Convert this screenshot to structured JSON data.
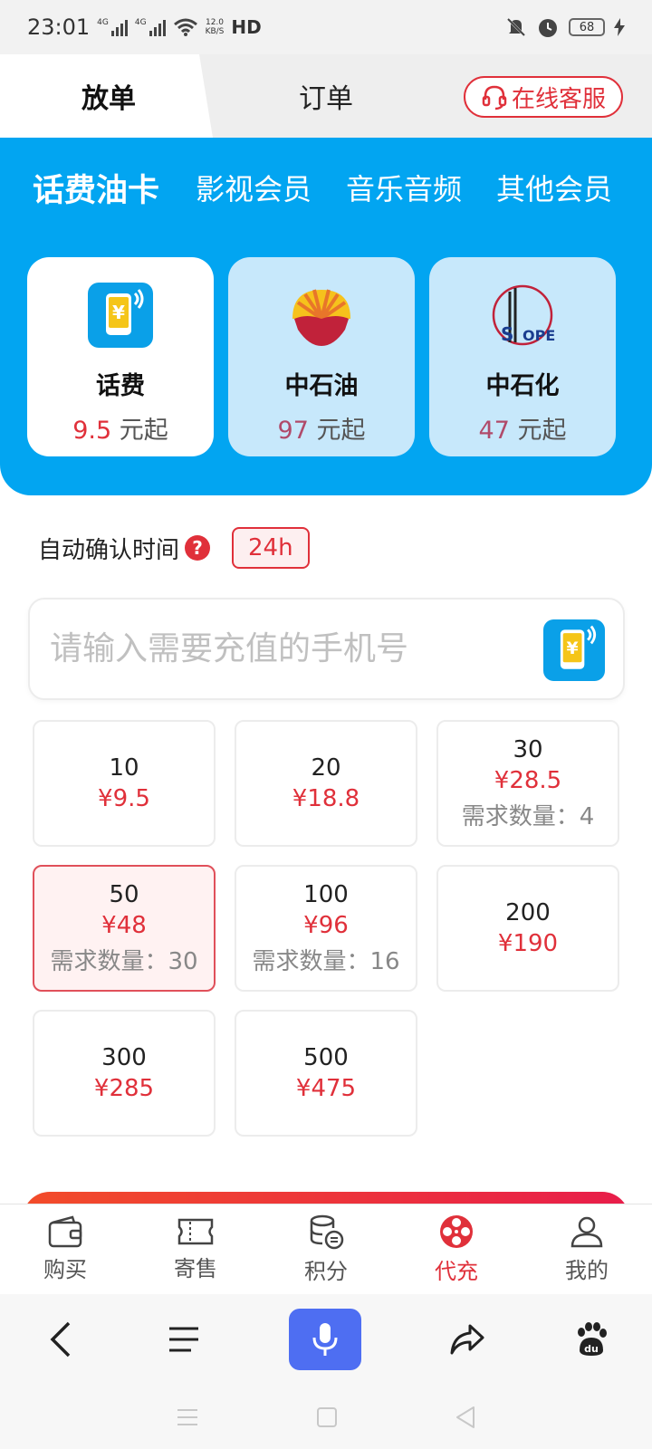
{
  "status_bar": {
    "time": "23:01",
    "signal_1": "4G",
    "signal_2": "4G",
    "net_speed_value": "12.0",
    "net_speed_unit": "KB/S",
    "hd": "HD",
    "battery": "68"
  },
  "top_tabs": {
    "tab_1": "放单",
    "tab_2": "订单",
    "service": "在线客服"
  },
  "category_tabs": [
    "话费油卡",
    "影视会员",
    "音乐音频",
    "其他会员"
  ],
  "cards": [
    {
      "title": "话费",
      "price": "9.5",
      "suffix": "元起",
      "icon": "phone-recharge-icon"
    },
    {
      "title": "中石油",
      "price": "97",
      "suffix": "元起",
      "icon": "petrochina-logo"
    },
    {
      "title": "中石化",
      "price": "47",
      "suffix": "元起",
      "icon": "sinopec-logo"
    }
  ],
  "auto_confirm": {
    "label": "自动确认时间",
    "value": "24h"
  },
  "phone_input": {
    "placeholder": "请输入需要充值的手机号",
    "value": ""
  },
  "amounts": [
    {
      "face": "10",
      "price": "¥9.5",
      "demand": ""
    },
    {
      "face": "20",
      "price": "¥18.8",
      "demand": ""
    },
    {
      "face": "30",
      "price": "¥28.5",
      "demand": "需求数量：4"
    },
    {
      "face": "50",
      "price": "¥48",
      "demand": "需求数量：30"
    },
    {
      "face": "100",
      "price": "¥96",
      "demand": "需求数量：16"
    },
    {
      "face": "200",
      "price": "¥190",
      "demand": ""
    },
    {
      "face": "300",
      "price": "¥285",
      "demand": ""
    },
    {
      "face": "500",
      "price": "¥475",
      "demand": ""
    }
  ],
  "bottom_nav": [
    {
      "label": "购买",
      "icon": "wallet-icon"
    },
    {
      "label": "寄售",
      "icon": "ticket-icon"
    },
    {
      "label": "积分",
      "icon": "points-icon"
    },
    {
      "label": "代充",
      "icon": "film-reel-icon"
    },
    {
      "label": "我的",
      "icon": "user-icon"
    }
  ],
  "colors": {
    "brand_blue": "#02a5f1",
    "accent_red": "#e0303a",
    "mic_blue": "#4e6ef2"
  }
}
